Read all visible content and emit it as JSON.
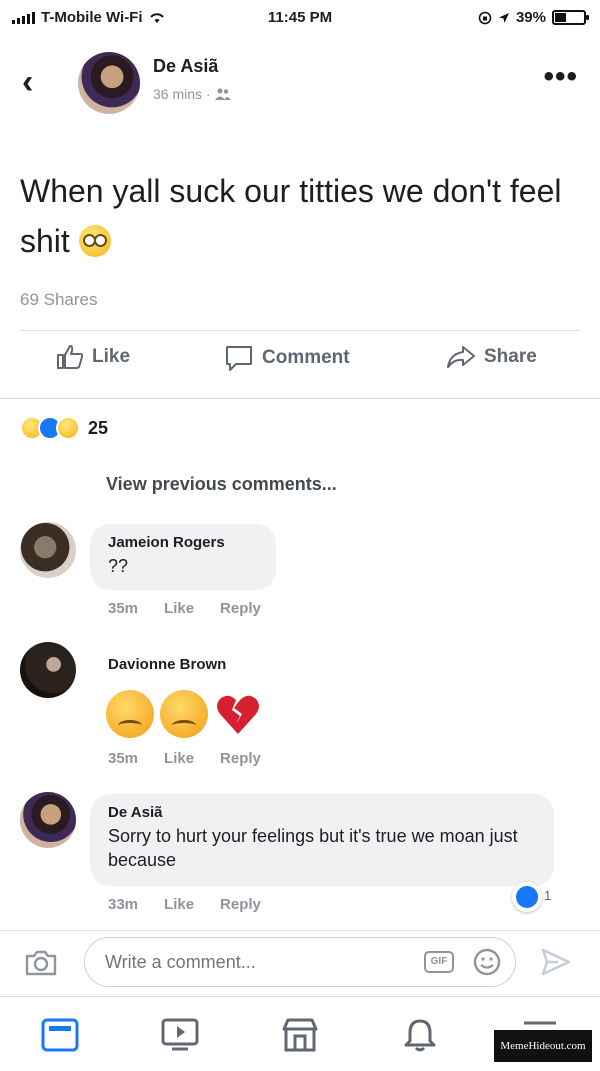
{
  "status_bar": {
    "carrier": "T-Mobile Wi-Fi",
    "time": "11:45 PM",
    "battery": "39%",
    "battery_level": 0.39
  },
  "post": {
    "author": "De Asiã",
    "meta": "36 mins ·",
    "text": "When yall suck our titties we don't feel shit",
    "shares": "69 Shares"
  },
  "actions": {
    "like": "Like",
    "comment": "Comment",
    "share": "Share"
  },
  "reactions": {
    "count": "25",
    "icons": [
      "haha-icon",
      "like-icon",
      "wow-icon"
    ]
  },
  "view_previous": "View previous comments...",
  "comments": [
    {
      "name": "Jameion Rogers",
      "text": "??",
      "time": "35m",
      "like": "Like",
      "reply": "Reply"
    },
    {
      "name": "Davionne Brown",
      "text": "",
      "emojis": [
        "disappointed-face-icon",
        "disappointed-face-icon",
        "broken-heart-icon"
      ],
      "time": "35m",
      "like": "Like",
      "reply": "Reply"
    },
    {
      "name": "De Asiã",
      "text": "Sorry to hurt your feelings but it's true we moan just because",
      "time": "33m",
      "like": "Like",
      "reply": "Reply",
      "reaction_count": "1"
    }
  ],
  "composer": {
    "placeholder": "Write a comment...",
    "gif": "GIF"
  },
  "watermark": "MemeHideout.com",
  "colors": {
    "accent": "#1877f2",
    "muted": "#90949c",
    "bubble": "#eff1f3"
  }
}
